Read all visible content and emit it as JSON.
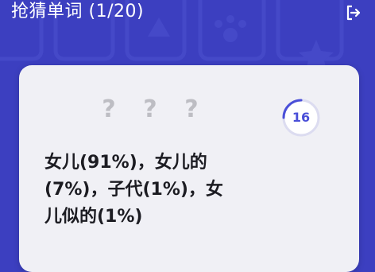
{
  "header": {
    "title": "抢猜单词 (1/20)",
    "exit_icon": "exit-icon"
  },
  "card": {
    "masked_letters": [
      "?",
      "?",
      "?"
    ],
    "timer": {
      "seconds": "16",
      "progress_fraction": 0.25,
      "ring_color": "#4a4fd8"
    },
    "answer_lines": [
      "女儿(91%)，女儿的",
      "(7%)，子代(1%)，女",
      "儿似的(1%)"
    ]
  },
  "colors": {
    "background": "#3c3fc0",
    "card": "#f0f0f5",
    "accent": "#4a4fd8"
  }
}
